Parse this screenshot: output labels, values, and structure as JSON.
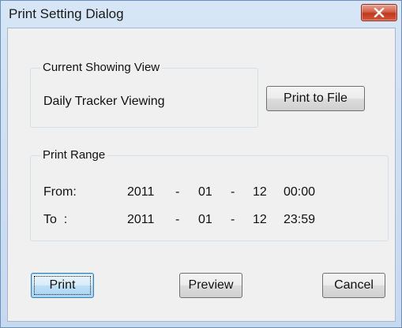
{
  "window": {
    "title": "Print Setting Dialog"
  },
  "current_view": {
    "group_title": "Current Showing View",
    "view_name": "Daily Tracker Viewing",
    "print_to_file_label": "Print to File"
  },
  "print_range": {
    "group_title": "Print Range",
    "from": {
      "label": "From:",
      "year": "2011",
      "sep1": "-",
      "month": "01",
      "sep2": "-",
      "day": "12",
      "time": "00:00"
    },
    "to": {
      "label": "To  :",
      "year": "2011",
      "sep1": "-",
      "month": "01",
      "sep2": "-",
      "day": "12",
      "time": "23:59"
    }
  },
  "buttons": {
    "print": "Print",
    "preview": "Preview",
    "cancel": "Cancel"
  }
}
